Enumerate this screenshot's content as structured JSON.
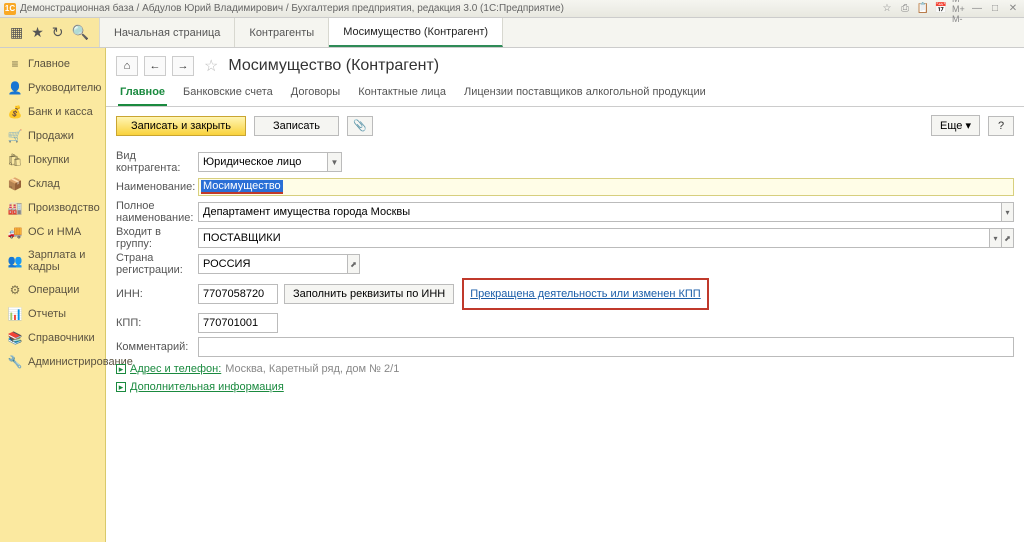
{
  "titlebar": {
    "text": "Демонстрационная база / Абдулов Юрий Владимирович / Бухгалтерия предприятия, редакция 3.0 (1С:Предприятие)"
  },
  "toolbar": {
    "tabs": [
      "Начальная страница",
      "Контрагенты",
      "Мосимущество (Контрагент)"
    ],
    "active": 2
  },
  "sidebar": {
    "items": [
      {
        "icon": "≡",
        "label": "Главное"
      },
      {
        "icon": "👤",
        "label": "Руководителю"
      },
      {
        "icon": "💰",
        "label": "Банк и касса"
      },
      {
        "icon": "🛒",
        "label": "Продажи"
      },
      {
        "icon": "🛍",
        "label": "Покупки"
      },
      {
        "icon": "📦",
        "label": "Склад"
      },
      {
        "icon": "🏭",
        "label": "Производство"
      },
      {
        "icon": "🚚",
        "label": "ОС и НМА"
      },
      {
        "icon": "👥",
        "label": "Зарплата и кадры"
      },
      {
        "icon": "⚙",
        "label": "Операции"
      },
      {
        "icon": "📊",
        "label": "Отчеты"
      },
      {
        "icon": "📚",
        "label": "Справочники"
      },
      {
        "icon": "🔧",
        "label": "Администрирование"
      }
    ]
  },
  "page": {
    "title": "Мосимущество (Контрагент)",
    "subtabs": [
      "Главное",
      "Банковские счета",
      "Договоры",
      "Контактные лица",
      "Лицензии поставщиков алкогольной продукции"
    ],
    "active_subtab": 0,
    "btn_save_close": "Записать и закрыть",
    "btn_save": "Записать",
    "btn_more": "Еще"
  },
  "form": {
    "l_type": "Вид контрагента:",
    "v_type": "Юридическое лицо",
    "l_name": "Наименование:",
    "v_name": "Мосимущество",
    "l_fullname": "Полное наименование:",
    "v_fullname": "Департамент имущества города Москвы",
    "l_group": "Входит в группу:",
    "v_group": "ПОСТАВЩИКИ",
    "l_country": "Страна регистрации:",
    "v_country": "РОССИЯ",
    "l_inn": "ИНН:",
    "v_inn": "7707058720",
    "btn_fill": "Заполнить реквизиты по ИНН",
    "warn_text": "Прекращена деятельность или изменен КПП",
    "l_kpp": "КПП:",
    "v_kpp": "770701001",
    "l_comment": "Комментарий:",
    "exp1_label": "Адрес и телефон:",
    "exp1_value": "Москва, Каретный ряд, дом № 2/1",
    "exp2_label": "Дополнительная информация"
  }
}
